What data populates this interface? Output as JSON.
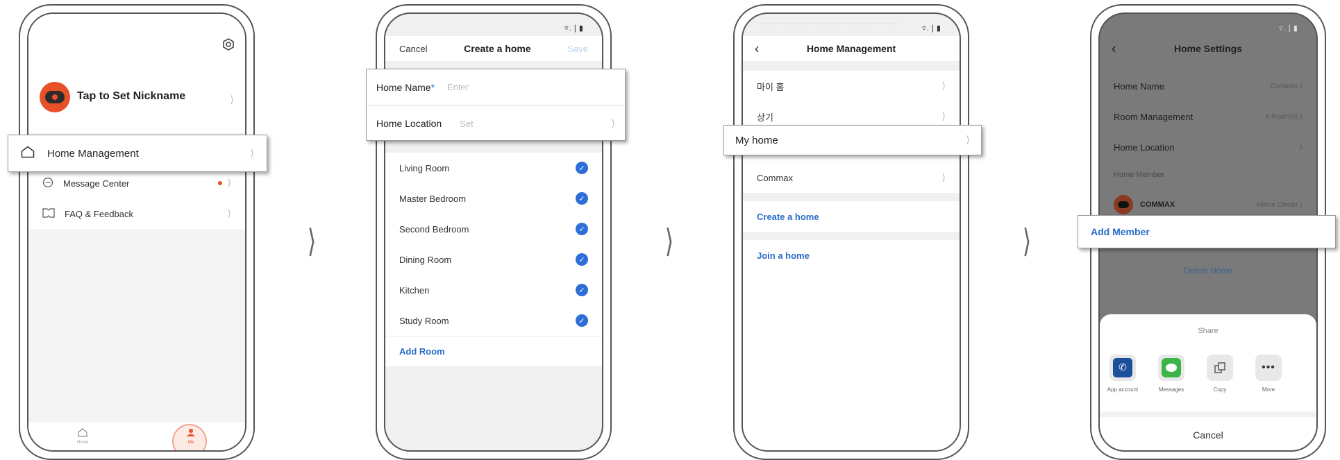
{
  "status_icons": "▿.❘▮",
  "arrow_glyph": "⟩",
  "screen1": {
    "nickname": "Tap to Set Nickname",
    "settings_icon": "gear-icon",
    "callout": "Home Management",
    "items": [
      {
        "label": "Message Center",
        "icon": "message-icon"
      },
      {
        "label": "FAQ & Feedback",
        "icon": "book-icon"
      }
    ],
    "tabs": [
      {
        "label": "Home",
        "icon": "home-icon"
      },
      {
        "label": "Me",
        "icon": "person-icon"
      }
    ],
    "accent": "#e8502a"
  },
  "screen2": {
    "cancel": "Cancel",
    "title": "Create a home",
    "save": "Save",
    "home_name_label": "Home Name",
    "required_mark": "*",
    "home_name_placeholder": "Enter",
    "home_location_label": "Home Location",
    "home_location_value": "Set",
    "rooms": [
      "Living Room",
      "Master Bedroom",
      "Second Bedroom",
      "Dining Room",
      "Kitchen",
      "Study Room"
    ],
    "add_room": "Add Room",
    "check_color": "#2d6ed8"
  },
  "screen3": {
    "title": "Home Management",
    "homes": [
      "마이 홈",
      "상기"
    ],
    "callout": "My home",
    "home_after": "Commax",
    "create": "Create a home",
    "join": "Join a home",
    "link_color": "#2a6cc9"
  },
  "screen4": {
    "title": "Home Settings",
    "rows": [
      {
        "label": "Home Name",
        "value": "Commax"
      },
      {
        "label": "Room Management",
        "value": "6 Room(s)"
      },
      {
        "label": "Home Location",
        "value": ""
      }
    ],
    "member_section": "Home Member",
    "member_name": "COMMAX",
    "member_role": "Home Owner",
    "callout": "Add Member",
    "delete": "Delete Home",
    "share_title": "Share",
    "share_items": [
      {
        "label": "App account",
        "icon": "phone-icon"
      },
      {
        "label": "Messages",
        "icon": "chat-icon"
      },
      {
        "label": "Copy",
        "icon": "copy-icon"
      },
      {
        "label": "More",
        "icon": "more-icon"
      }
    ],
    "share_cancel": "Cancel"
  }
}
